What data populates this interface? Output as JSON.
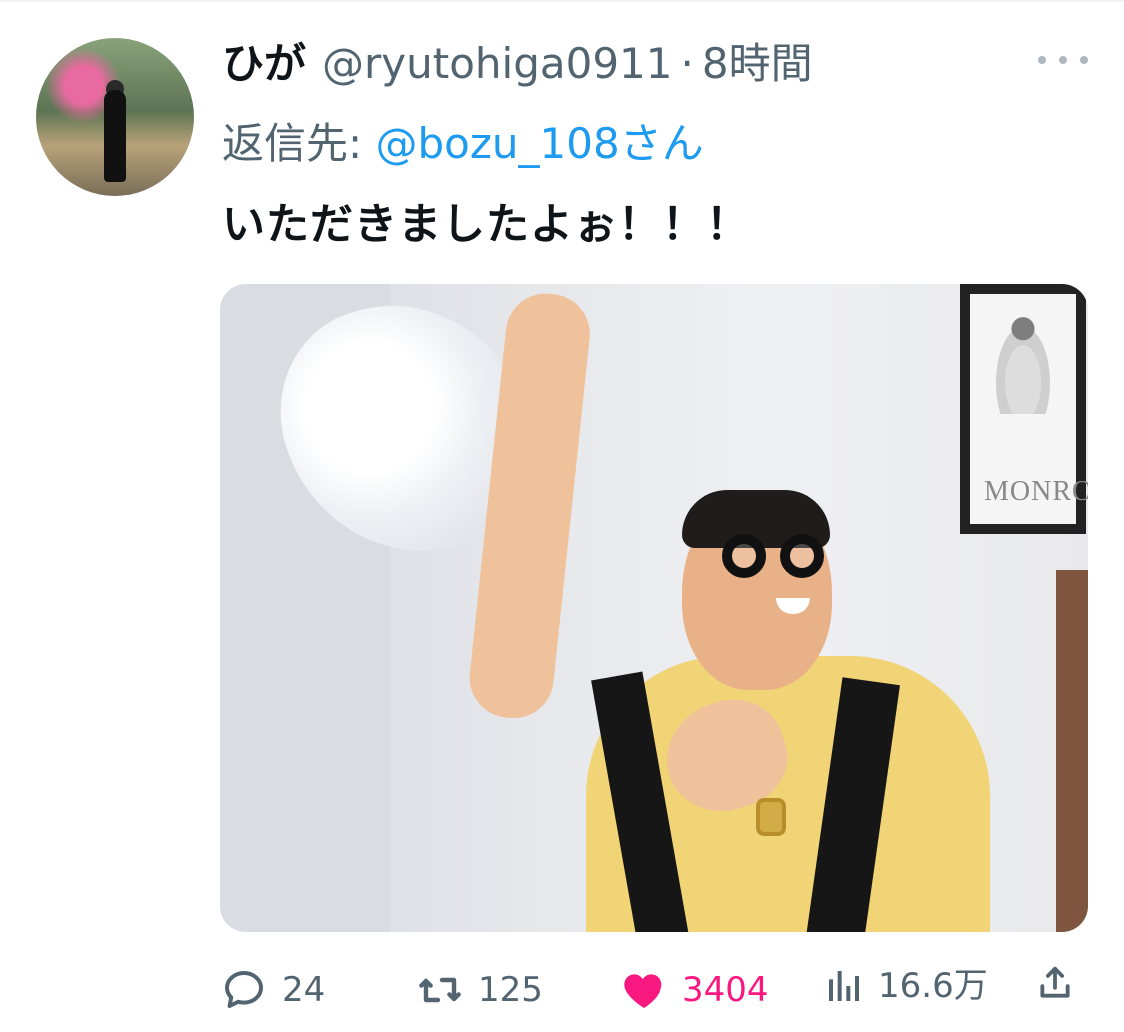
{
  "tweet": {
    "display_name": "ひが",
    "handle": "@ryutohiga0911",
    "separator": "·",
    "time": "8時間",
    "reply_prefix": "返信先:",
    "reply_to": "@bozu_108さん",
    "text": "いただきましたよぉ！！！"
  },
  "media": {
    "poster_text": "MONRO"
  },
  "actions": {
    "reply_count": "24",
    "repost_count": "125",
    "like_count": "3404",
    "view_count": "16.6万"
  },
  "colors": {
    "text": "#0f1419",
    "secondary": "#536471",
    "link": "#1d9bf0",
    "like": "#f91880"
  },
  "icons": {
    "reply": "reply-bubble-icon",
    "repost": "repost-icon",
    "like": "heart-icon",
    "views": "analytics-icon",
    "share": "share-icon",
    "more": "more-icon"
  }
}
